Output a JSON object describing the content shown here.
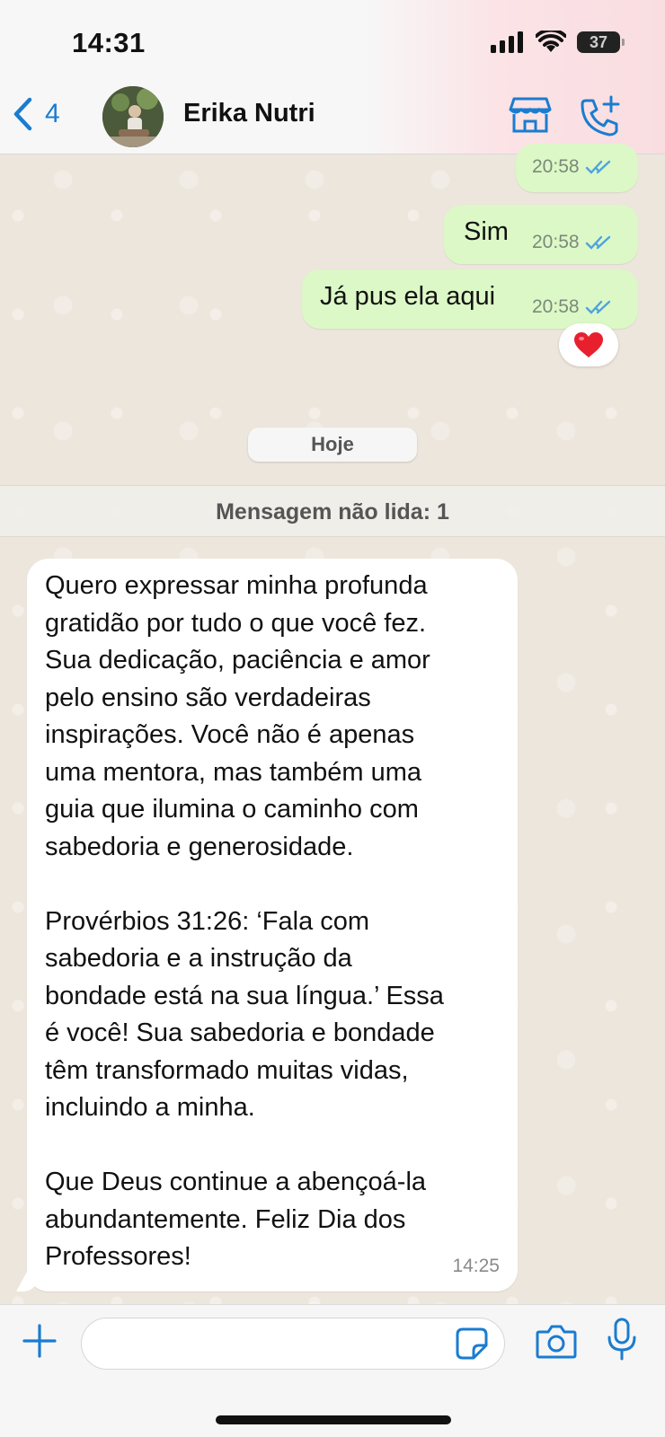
{
  "status_bar": {
    "time": "14:31",
    "battery": "37"
  },
  "header": {
    "back_count": "4",
    "contact_name": "Erika Nutri"
  },
  "messages_out": [
    {
      "text": "",
      "time": "20:58"
    },
    {
      "text": "Sim",
      "time": "20:58"
    },
    {
      "text": "Já pus ela aqui",
      "time": "20:58",
      "reaction": "❤️"
    }
  ],
  "date_separator": "Hoje",
  "unread_label": "Mensagem não lida: 1",
  "message_in": {
    "text": "Quero expressar minha profunda\ngratidão por tudo o que você fez.\nSua dedicação, paciência e amor\npelo ensino são verdadeiras\ninspirações. Você não é apenas\numa mentora, mas também uma\nguia que ilumina o caminho com\nsabedoria e generosidade.\n\nProvérbios 31:26: ‘Fala com\nsabedoria e a instrução da\nbondade está na sua língua.’ Essa\né você! Sua sabedoria e bondade\ntêm transformado muitas vidas,\nincluindo a minha.\n\nQue Deus continue a abençoá-la\nabundantemente. Feliz Dia dos\nProfessores!",
    "time": "14:25"
  },
  "colors": {
    "accent": "#1a7cd0",
    "outgoing_bubble": "#dcf8c6",
    "read_ticks": "#4fa3e0"
  }
}
